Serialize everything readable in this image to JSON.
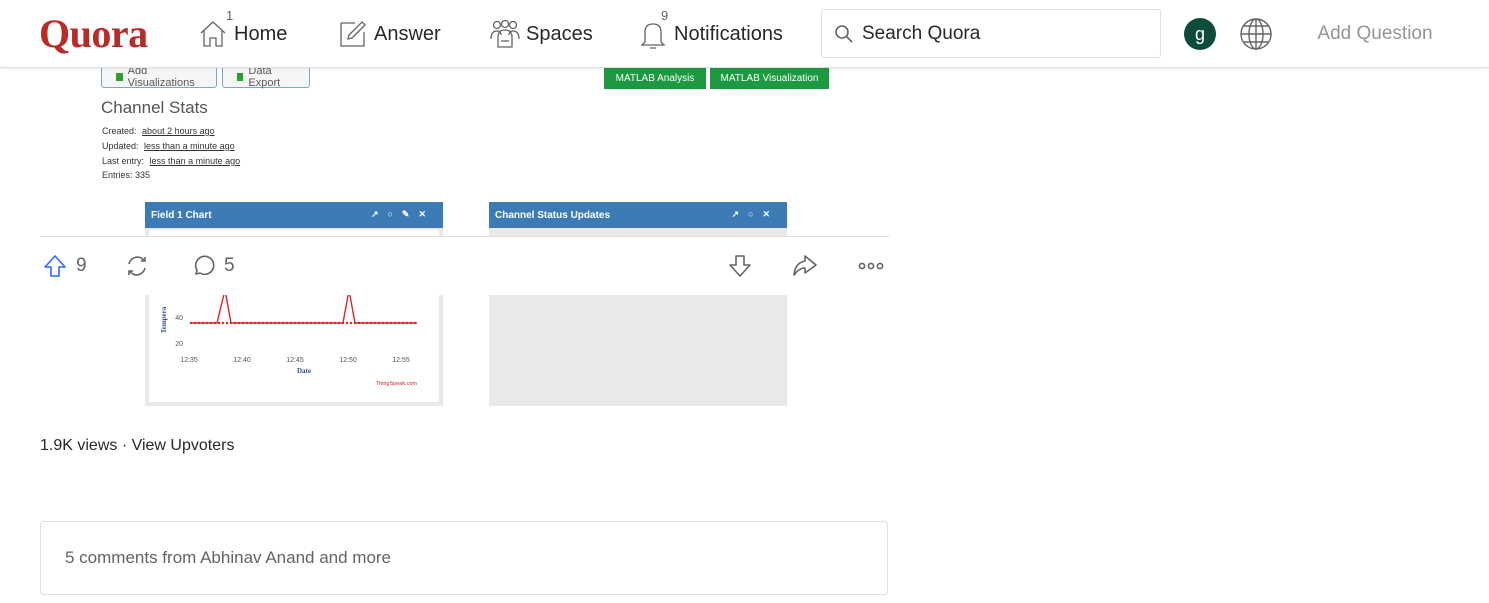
{
  "header": {
    "logo": "Quora",
    "nav": [
      {
        "label": "Home",
        "badge": "1",
        "icon": "home-icon"
      },
      {
        "label": "Answer",
        "badge": "",
        "icon": "pencil-square-icon"
      },
      {
        "label": "Spaces",
        "badge": "",
        "icon": "people-icon"
      },
      {
        "label": "Notifications",
        "badge": "9",
        "icon": "bell-icon"
      }
    ],
    "search_placeholder": "Search Quora",
    "avatar_initial": "g",
    "add_question": "Add Question"
  },
  "embed": {
    "buttons": {
      "add_visualizations": "Add Visualizations",
      "data_export": "Data Export",
      "matlab_analysis": "MATLAB Analysis",
      "matlab_visualization": "MATLAB Visualization"
    },
    "channel_stats": {
      "title": "Channel Stats",
      "created_label": "Created:",
      "created_value": "about 2 hours ago",
      "updated_label": "Updated:",
      "updated_value": "less than a minute ago",
      "last_entry_label": "Last entry:",
      "last_entry_value": "less than a minute ago",
      "entries": "Entries: 335"
    },
    "panels": {
      "field_chart": "Field 1 Chart",
      "status_updates": "Channel Status Updates"
    },
    "chart_data": {
      "type": "line",
      "x_ticks": [
        "12:35",
        "12:40",
        "12:45",
        "12:50",
        "12:55"
      ],
      "y_ticks": [
        "20",
        "40"
      ],
      "xlabel": "Date",
      "ylabel": "Tempera",
      "credit": "ThingSpeak.com",
      "color": "#d62728"
    }
  },
  "actions": {
    "upvotes": "9",
    "comments": "5"
  },
  "views_text": "1.9K views · View Upvoters",
  "comments_summary": "5 comments from Abhinav Anand and more"
}
